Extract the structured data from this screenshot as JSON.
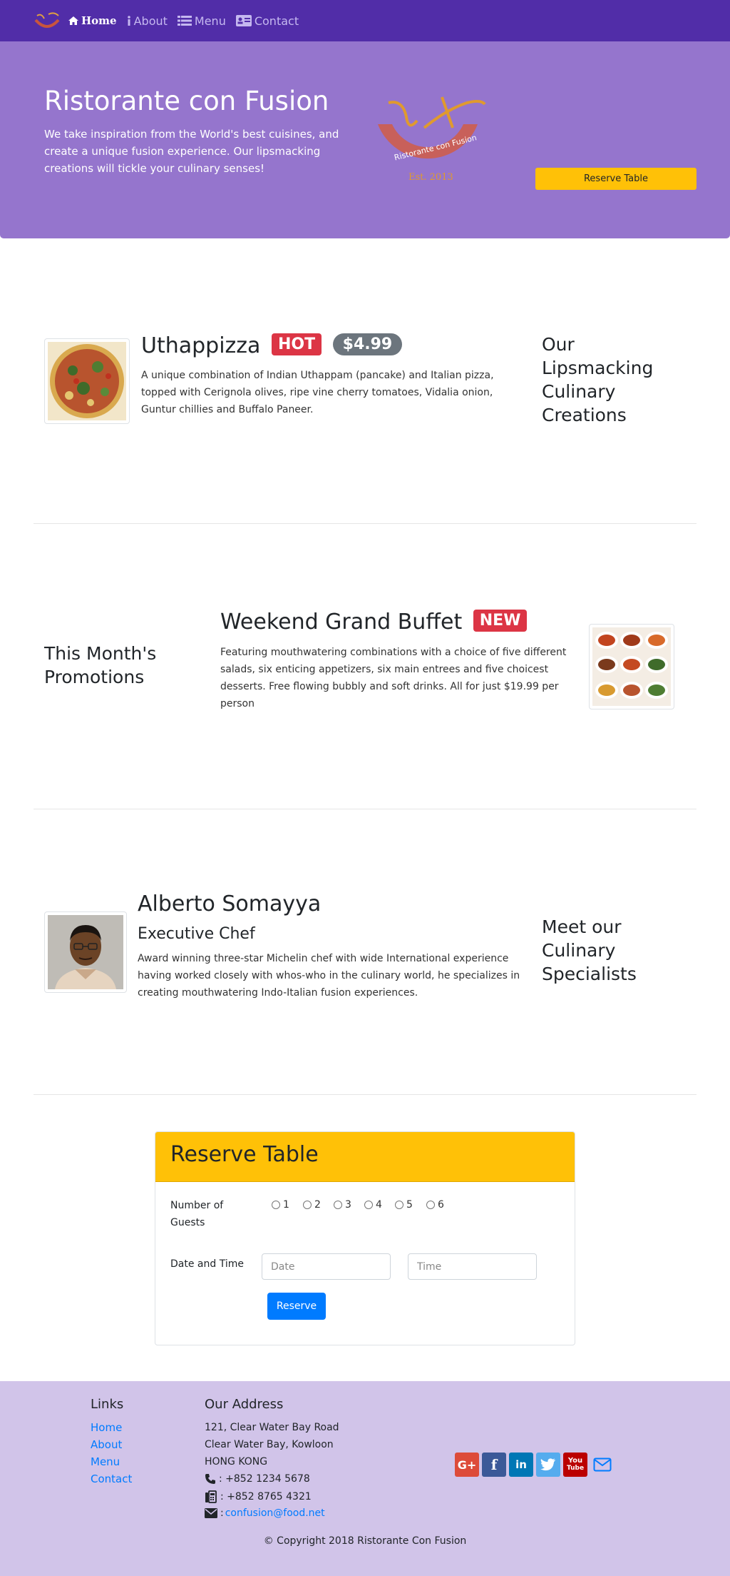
{
  "nav": {
    "home_label": "Home",
    "about_label": "About",
    "menu_label": "Menu",
    "contact_label": "Contact"
  },
  "jumbotron": {
    "title": "Ristorante con Fusion",
    "text": "We take inspiration from the World's best cuisines, and create a unique fusion experience. Our lipsmacking creations will tickle your culinary senses!",
    "logo_text": "Ristorante con Fusion",
    "logo_est": "Est. 2013",
    "reserve_button": "Reserve Table"
  },
  "dish": {
    "name": "Uthappizza",
    "badge": "HOT",
    "price": "$4.99",
    "description": "A unique combination of Indian Uthappam (pancake) and Italian pizza, topped with Cerignola olives, ripe vine cherry tomatoes, Vidalia onion, Guntur chillies and Buffalo Paneer.",
    "side_heading": "Our Lipsmacking Culinary Creations"
  },
  "promotion": {
    "side_heading": "This Month's Promotions",
    "name": "Weekend Grand Buffet",
    "badge": "NEW",
    "description": "Featuring mouthwatering combinations with a choice of five different salads, six enticing appetizers, six main entrees and five choicest desserts. Free flowing bubbly and soft drinks. All for just $19.99 per person"
  },
  "leader": {
    "name": "Alberto Somayya",
    "designation": "Executive Chef",
    "description": "Award winning three-star Michelin chef with wide International experience having worked closely with whos-who in the culinary world, he specializes in creating mouthwatering Indo-Italian fusion experiences.",
    "side_heading": "Meet our Culinary Specialists"
  },
  "reserve_form": {
    "title": "Reserve Table",
    "guests_label": "Number of Guests",
    "guest_options": [
      "1",
      "2",
      "3",
      "4",
      "5",
      "6"
    ],
    "datetime_label": "Date and Time",
    "date_placeholder": "Date",
    "time_placeholder": "Time",
    "submit_label": "Reserve"
  },
  "footer": {
    "links_heading": "Links",
    "links": [
      "Home",
      "About",
      "Menu",
      "Contact"
    ],
    "address_heading": "Our Address",
    "address_lines": [
      "121, Clear Water Bay Road",
      "Clear Water Bay, Kowloon",
      "HONG KONG"
    ],
    "phone": ": +852 1234 5678",
    "fax": ": +852 8765 4321",
    "email": "confusion@food.net",
    "social_icons": [
      "google-plus-icon",
      "facebook-icon",
      "linkedin-icon",
      "twitter-icon",
      "youtube-icon",
      "mail-icon"
    ],
    "copyright": "© Copyright 2018 Ristorante Con Fusion"
  },
  "colors": {
    "primary": "#512DA8",
    "jumbotron": "#9575CD",
    "footer": "#D1C4E9",
    "warning": "#FFC107",
    "danger": "#DC3545",
    "link": "#007BFF"
  }
}
